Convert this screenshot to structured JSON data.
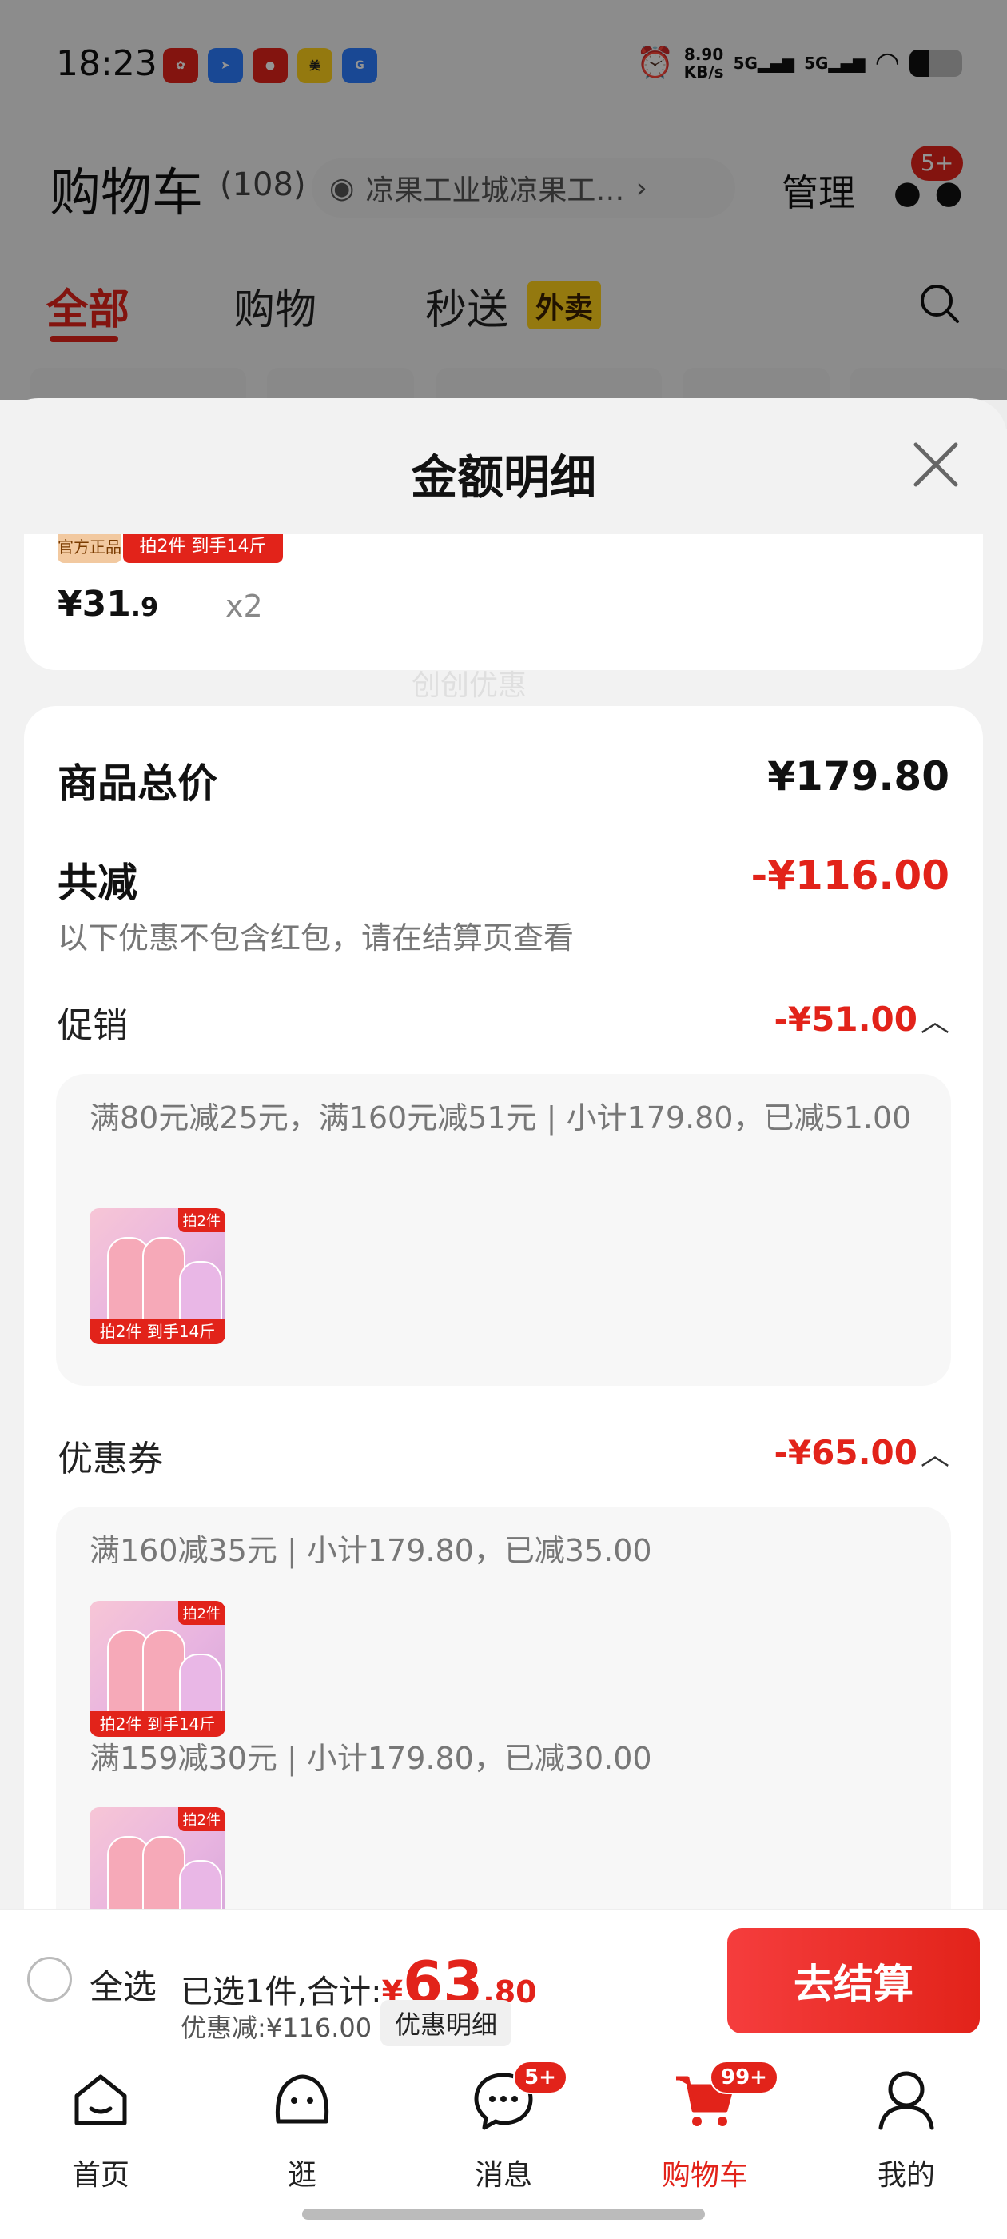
{
  "status_bar": {
    "time": "18:23",
    "net_speed": "8.90\nKB/s",
    "net_speed_line1": "8.90",
    "net_speed_line2": "KB/s",
    "sig1": "5G",
    "sig2": "5G"
  },
  "header": {
    "title": "购物车",
    "count": "(108)",
    "address": "凉果工业城凉果工…",
    "manage": "管理",
    "more_badge": "5+"
  },
  "tabs": [
    {
      "label": "全部"
    },
    {
      "label": "购物"
    },
    {
      "label": "秒送"
    }
  ],
  "tab_tag": "外卖",
  "sheet": {
    "title": "金额明细",
    "item": {
      "price_main": "¥31",
      "price_dec": ".9",
      "qty": "x2",
      "promo_tag": "拍2件 到手14斤",
      "official_tag": "官方正品"
    },
    "total_label": "商品总价",
    "total_value": "¥179.80",
    "reduce_label": "共减",
    "reduce_value": "-¥116.00",
    "reduce_note": "以下优惠不包含红包，请在结算页查看",
    "promo_label": "促销",
    "promo_value": "-¥51.00",
    "promo_note": "满80元减25元，满160元减51元 | 小计179.80，已减51.00",
    "coupon_label": "优惠券",
    "coupon_value": "-¥65.00",
    "coupon_note1": "满160减35元 | 小计179.80，已减35.00",
    "coupon_note2": "满159减30元 | 小计179.80，已减30.00",
    "watermark": "创创优惠",
    "thumb_tag": "拍2件 到手14斤",
    "thumb_corner": "拍2件"
  },
  "bottom_bar": {
    "select_all": "全选",
    "selected_text": "已选1件,合计:",
    "currency": "¥",
    "total_int": "63",
    "total_dec": ".80",
    "discount": "优惠减:¥116.00",
    "detail_btn": "优惠明细",
    "checkout": "去结算"
  },
  "nav": [
    {
      "label": "首页"
    },
    {
      "label": "逛"
    },
    {
      "label": "消息",
      "badge": "5+"
    },
    {
      "label": "购物车",
      "badge": "99+"
    },
    {
      "label": "我的"
    }
  ],
  "colors": {
    "accent": "#e2231a"
  }
}
